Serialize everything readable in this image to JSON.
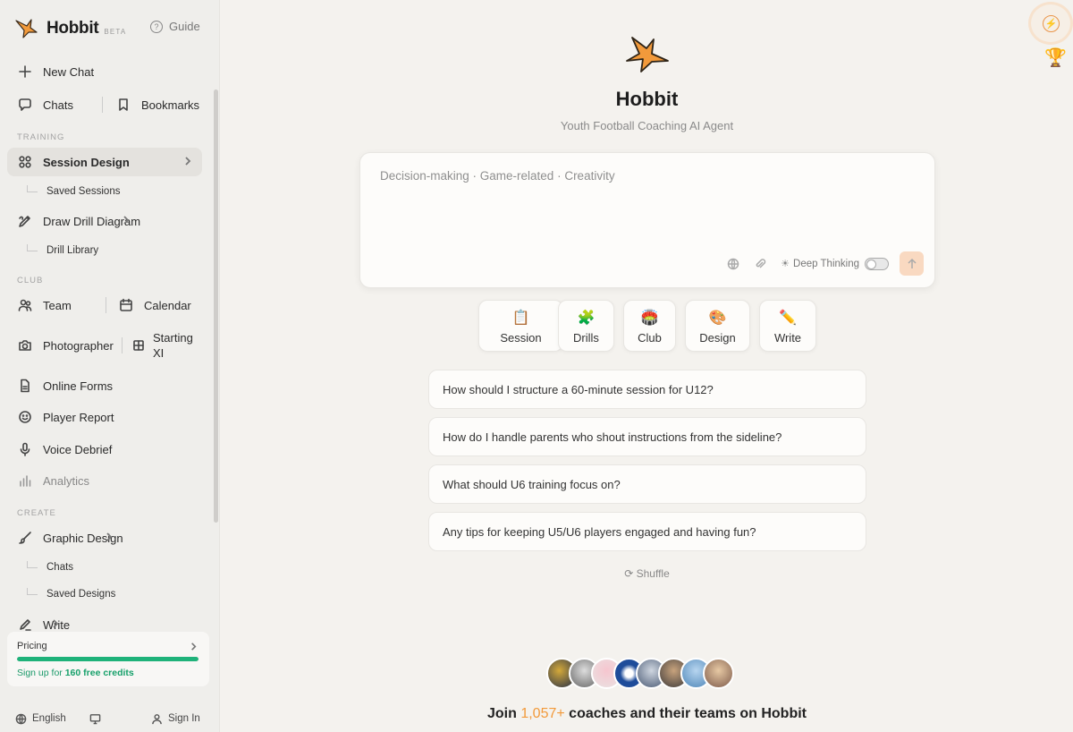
{
  "brand": {
    "name": "Hobbit",
    "badge": "BETA",
    "guide": "Guide"
  },
  "sidebar": {
    "new_chat": "New Chat",
    "chats": "Chats",
    "bookmarks": "Bookmarks",
    "sections": {
      "training": "TRAINING",
      "club": "CLUB",
      "create": "CREATE"
    },
    "session_design": "Session Design",
    "saved_sessions": "Saved Sessions",
    "draw_drill": "Draw Drill Diagram",
    "drill_library": "Drill Library",
    "team": "Team",
    "calendar": "Calendar",
    "photographer": "Photographer",
    "starting_xi": "Starting XI",
    "online_forms": "Online Forms",
    "player_report": "Player Report",
    "voice_debrief": "Voice Debrief",
    "analytics": "Analytics",
    "graphic_design": "Graphic Design",
    "gd_chats": "Chats",
    "saved_designs": "Saved Designs",
    "write": "Write"
  },
  "pricing": {
    "title": "Pricing",
    "progress": 1.0,
    "note_prefix": "Sign up for",
    "note_highlight": "160 free credits"
  },
  "footer": {
    "language": "English",
    "sign_in": "Sign In"
  },
  "hero": {
    "title": "Hobbit",
    "subtitle": "Youth Football Coaching AI Agent"
  },
  "composer": {
    "placeholder": "Decision-making · Game-related · Creativity",
    "deep_thinking": "Deep Thinking",
    "deep_thinking_on": false
  },
  "cards": [
    {
      "emoji": "📋",
      "label": "Session"
    },
    {
      "emoji": "🧩",
      "label": "Drills"
    },
    {
      "emoji": "🏟️",
      "label": "Club"
    },
    {
      "emoji": "🎨",
      "label": "Design"
    },
    {
      "emoji": "✏️",
      "label": "Write"
    }
  ],
  "prompts": [
    "How should I structure a 60-minute session for U12?",
    "How do I handle parents who shout instructions from the sideline?",
    "What should U6 training focus on?",
    "Any tips for keeping U5/U6 players engaged and having fun?"
  ],
  "shuffle": "Shuffle",
  "community": {
    "prefix": "Join",
    "count": "1,057+",
    "suffix": "coaches and their teams on Hobbit"
  },
  "colors": {
    "accent": "#f29a3b",
    "success": "#1fb27a",
    "background": "#f4f2ee",
    "sidebar": "#efeeeb"
  }
}
